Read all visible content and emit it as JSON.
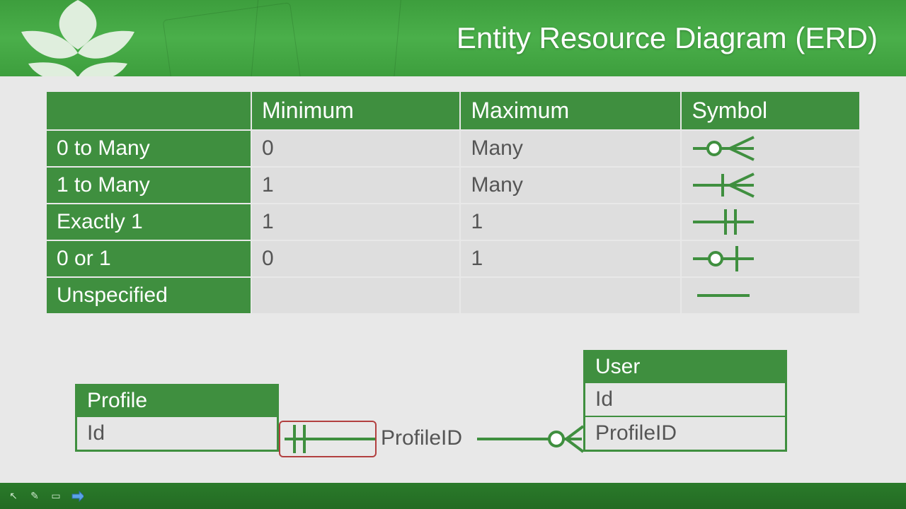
{
  "header": {
    "title": "Entity Resource Diagram (ERD)"
  },
  "table": {
    "headers": {
      "col0": "",
      "minimum": "Minimum",
      "maximum": "Maximum",
      "symbol": "Symbol"
    },
    "rows": [
      {
        "name": "0 to Many",
        "min": "0",
        "max": "Many",
        "symbol": "zero-many"
      },
      {
        "name": "1 to Many",
        "min": "1",
        "max": "Many",
        "symbol": "one-many"
      },
      {
        "name": "Exactly 1",
        "min": "1",
        "max": "1",
        "symbol": "exactly-one"
      },
      {
        "name": "0 or 1",
        "min": "0",
        "max": "1",
        "symbol": "zero-one"
      },
      {
        "name": "Unspecified",
        "min": "",
        "max": "",
        "symbol": "unspecified"
      }
    ]
  },
  "erd": {
    "left_entity": {
      "title": "Profile",
      "rows": [
        "Id"
      ]
    },
    "right_entity": {
      "title": "User",
      "rows": [
        "Id",
        "ProfileID"
      ]
    },
    "relationship_label": "ProfileID",
    "left_cardinality": "exactly-one",
    "right_cardinality": "zero-many"
  },
  "colors": {
    "accent": "#3f8f3f",
    "highlight": "#b24040"
  }
}
